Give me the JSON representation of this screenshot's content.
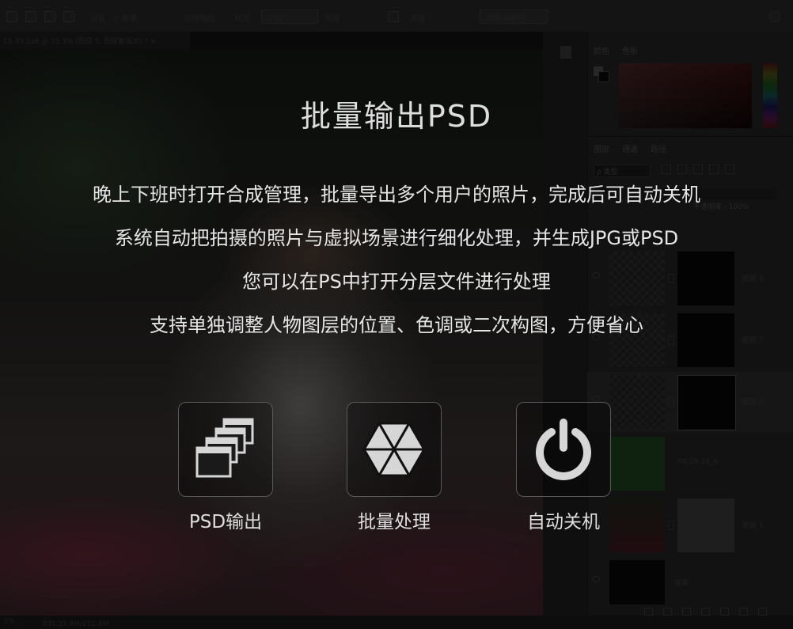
{
  "ps": {
    "options_bar": {
      "feather": "羽化 : 0 像素",
      "antialias": "消除锯齿",
      "style_label": "样式 :",
      "style_value": "正常",
      "width_label": "宽度 :",
      "height_label": "高度 :",
      "select_mask_button": "选择并遮住 ..."
    },
    "document_tab": "19-39.psd @ 33.3% (图层 5, 图层蒙版/8) * ×",
    "panels": {
      "color_tab": "颜色",
      "swatches_tab": "色板",
      "layers_tab": "图层",
      "channels_tab": "通道",
      "paths_tab": "路径",
      "filter_kind": "ρ 类型",
      "opacity": "不透明度 : 100%"
    },
    "layers": [
      {
        "name": "图层 9"
      },
      {
        "name": "图层 7"
      },
      {
        "name": "图层 5"
      },
      {
        "name": "09-19-39_0"
      },
      {
        "name": "图层 1"
      },
      {
        "name": "背景"
      }
    ],
    "status": {
      "zoom": "3%",
      "doc_size": "文档:35.4M/231.4M"
    }
  },
  "promo": {
    "title": "批量输出PSD",
    "lines": [
      "晚上下班时打开合成管理，批量导出多个用户的照片，完成后可自动关机",
      "系统自动把拍摄的照片与虚拟场景进行细化处理，并生成JPG或PSD",
      "您可以在PS中打开分层文件进行处理",
      "支持单独调整人物图层的位置、色调或二次构图，方便省心"
    ],
    "features": [
      {
        "label": "PSD输出",
        "icon": "stacked-windows-icon"
      },
      {
        "label": "批量处理",
        "icon": "hexagon-segments-icon"
      },
      {
        "label": "自动关机",
        "icon": "power-icon"
      }
    ]
  }
}
